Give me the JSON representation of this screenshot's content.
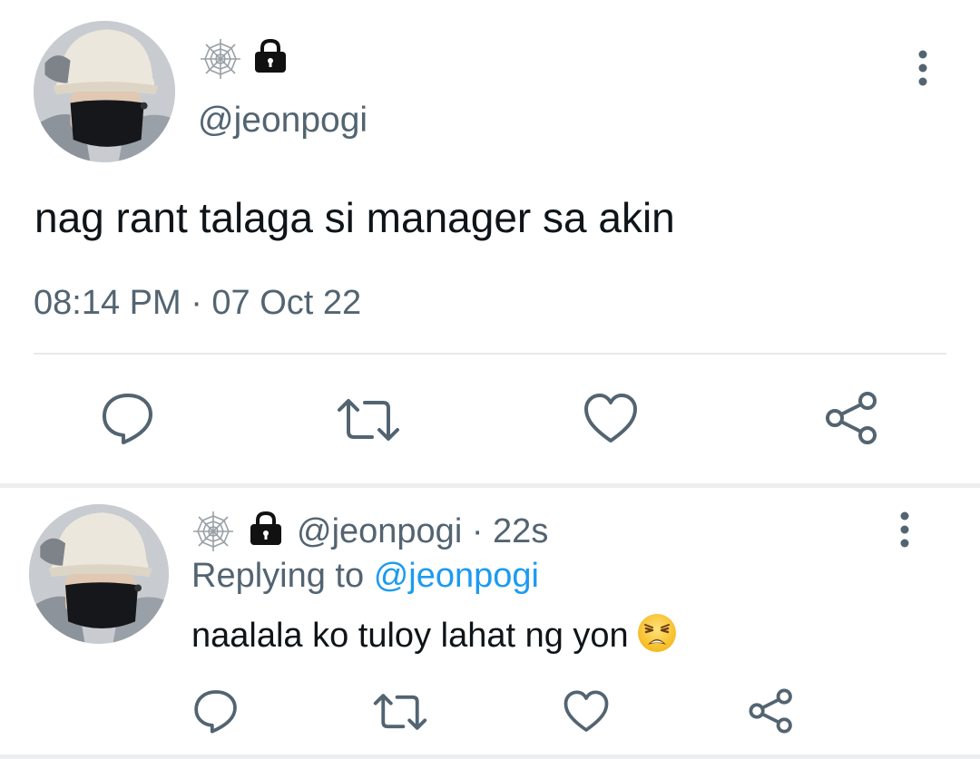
{
  "main_tweet": {
    "handle": "@jeonpogi",
    "text": "nag rant talaga si manager sa akin",
    "timestamp": "08:14 PM · 07 Oct 22",
    "icons": {
      "avatar": "avatar-photo",
      "name_emoji": "spider-web-icon",
      "protected": "lock-icon",
      "more": "more-vertical-icon"
    },
    "actions": [
      "reply-icon",
      "retweet-icon",
      "like-icon",
      "share-icon"
    ]
  },
  "reply_tweet": {
    "handle": "@jeonpogi",
    "separator": "·",
    "age": "22s",
    "replying_prefix": "Replying to",
    "replying_handle": "@jeonpogi",
    "text": "naalala ko tuloy lahat ng yon",
    "emoji": "weary-face-emoji",
    "icons": {
      "avatar": "avatar-photo",
      "name_emoji": "spider-web-icon",
      "protected": "lock-icon",
      "more": "more-vertical-icon"
    },
    "actions": [
      "reply-icon",
      "retweet-icon",
      "like-icon",
      "share-icon"
    ]
  },
  "colors": {
    "text_primary": "#0f1419",
    "text_secondary": "#536471",
    "link": "#1d9bf0",
    "divider": "#e6e9ec",
    "icon": "#536471"
  }
}
